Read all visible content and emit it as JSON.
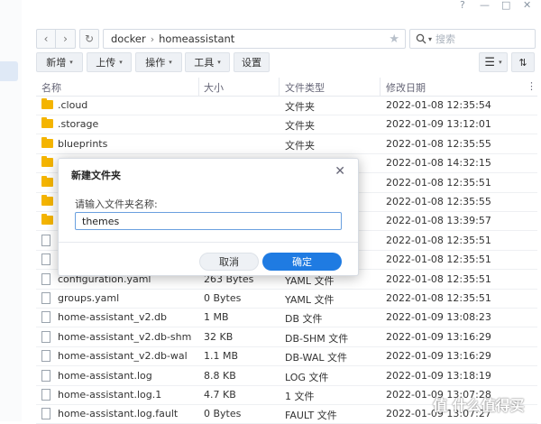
{
  "window": {
    "help_glyph": "?",
    "minimize_glyph": "—",
    "maximize_glyph": "□",
    "close_glyph": "✕"
  },
  "nav": {
    "back_glyph": "‹",
    "forward_glyph": "›",
    "refresh_glyph": "↻",
    "path": [
      "docker",
      "homeassistant"
    ],
    "path_sep": "›",
    "star_glyph": "★",
    "search_placeholder": "搜索"
  },
  "toolbar": {
    "new_label": "新增",
    "upload_label": "上传",
    "action_label": "操作",
    "tools_label": "工具",
    "settings_label": "设置",
    "caret": "▾",
    "view_list_glyph": "☰",
    "sort_glyph": "⇅"
  },
  "columns": {
    "name": "名称",
    "size": "大小",
    "type": "文件类型",
    "date": "修改日期",
    "more": "⋮"
  },
  "files": [
    {
      "name": ".cloud",
      "size": "",
      "type": "文件夹",
      "date": "2022-01-08 12:35:54",
      "icon": "folder"
    },
    {
      "name": ".storage",
      "size": "",
      "type": "文件夹",
      "date": "2022-01-09 13:12:01",
      "icon": "folder"
    },
    {
      "name": "blueprints",
      "size": "",
      "type": "文件夹",
      "date": "2022-01-08 12:35:55",
      "icon": "folder"
    },
    {
      "name": "",
      "size": "",
      "type": "",
      "date": "2022-01-08 14:32:15",
      "icon": "folder"
    },
    {
      "name": "",
      "size": "",
      "type": "",
      "date": "2022-01-08 12:35:51",
      "icon": "folder"
    },
    {
      "name": "",
      "size": "",
      "type": "",
      "date": "2022-01-08 12:35:55",
      "icon": "folder"
    },
    {
      "name": "",
      "size": "",
      "type": "",
      "date": "2022-01-08 13:39:57",
      "icon": "folder"
    },
    {
      "name": "",
      "size": "",
      "type": "",
      "date": "2022-01-08 12:35:51",
      "icon": "file"
    },
    {
      "name": "",
      "size": "",
      "type": "",
      "date": "2022-01-08 12:35:51",
      "icon": "file"
    },
    {
      "name": "configuration.yaml",
      "size": "263 Bytes",
      "type": "YAML 文件",
      "date": "2022-01-08 12:35:51",
      "icon": "file"
    },
    {
      "name": "groups.yaml",
      "size": "0 Bytes",
      "type": "YAML 文件",
      "date": "2022-01-08 12:35:51",
      "icon": "file"
    },
    {
      "name": "home-assistant_v2.db",
      "size": "1 MB",
      "type": "DB 文件",
      "date": "2022-01-09 13:08:23",
      "icon": "file"
    },
    {
      "name": "home-assistant_v2.db-shm",
      "size": "32 KB",
      "type": "DB-SHM 文件",
      "date": "2022-01-09 13:16:29",
      "icon": "file"
    },
    {
      "name": "home-assistant_v2.db-wal",
      "size": "1.1 MB",
      "type": "DB-WAL 文件",
      "date": "2022-01-09 13:16:29",
      "icon": "file"
    },
    {
      "name": "home-assistant.log",
      "size": "8.8 KB",
      "type": "LOG 文件",
      "date": "2022-01-09 13:18:19",
      "icon": "file"
    },
    {
      "name": "home-assistant.log.1",
      "size": "4.7 KB",
      "type": "1 文件",
      "date": "2022-01-09 13:07:28",
      "icon": "file"
    },
    {
      "name": "home-assistant.log.fault",
      "size": "0 Bytes",
      "type": "FAULT 文件",
      "date": "2022-01-09 13:07:27",
      "icon": "file"
    }
  ],
  "dialog": {
    "title": "新建文件夹",
    "close_glyph": "✕",
    "prompt": "请输入文件夹名称:",
    "input_value": "themes",
    "cancel_label": "取消",
    "ok_label": "确定"
  },
  "watermark": "值 什么值得买",
  "colors": {
    "accent": "#1f7be2",
    "folder": "#f4b400"
  }
}
